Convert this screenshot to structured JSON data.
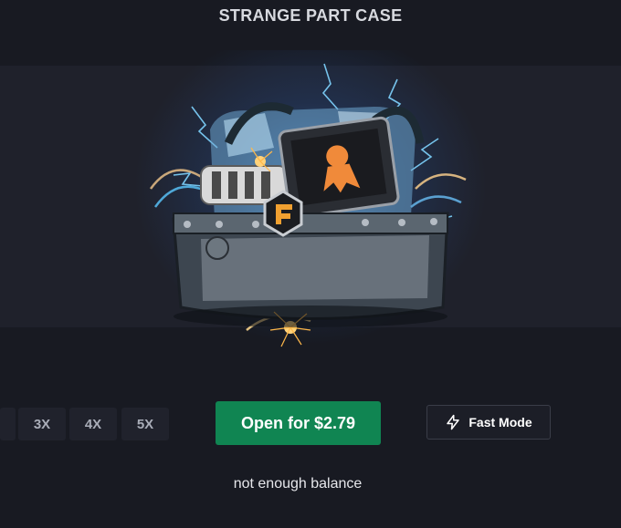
{
  "case": {
    "title": "STRANGE PART CASE",
    "image_icon": "strange-part-case-image"
  },
  "multipliers": [
    {
      "label": ""
    },
    {
      "label": "3X"
    },
    {
      "label": "4X"
    },
    {
      "label": "5X"
    }
  ],
  "open_button": {
    "label": "Open for $2.79",
    "color": "#108552"
  },
  "fast_mode": {
    "label": "Fast Mode",
    "icon": "lightning-icon"
  },
  "status": {
    "message": "not enough balance"
  },
  "colors": {
    "background": "#181a22",
    "banner": "#1f212b"
  }
}
